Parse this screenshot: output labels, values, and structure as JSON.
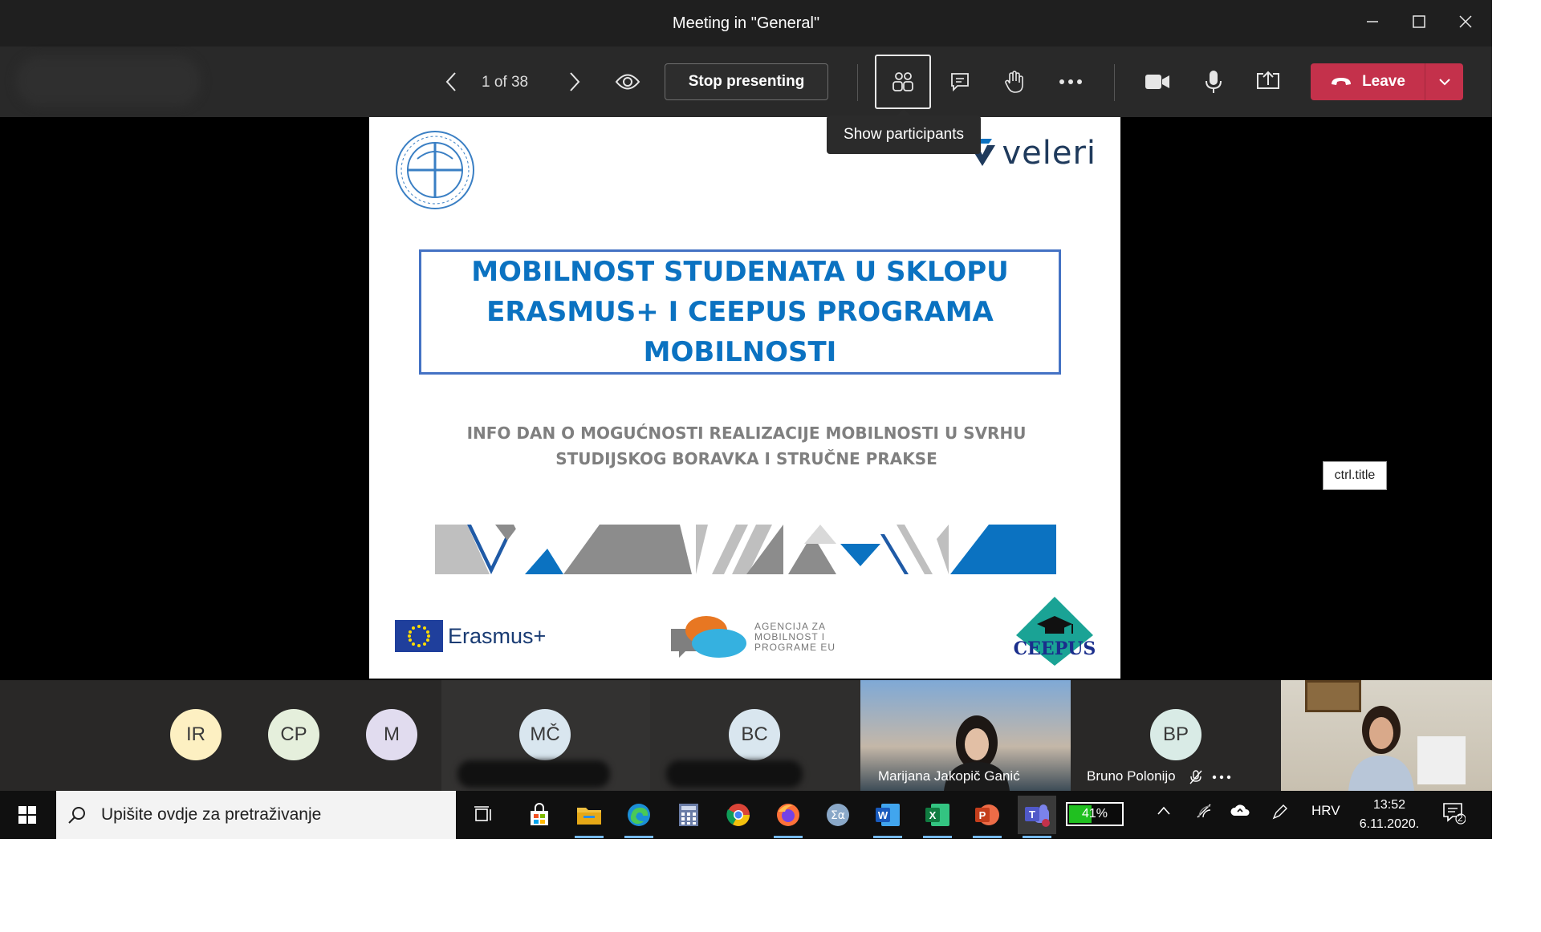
{
  "window": {
    "title": "Meeting in \"General\"",
    "minimize_icon": "minimize-icon",
    "maximize_icon": "maximize-icon",
    "close_icon": "close-icon"
  },
  "toolbar": {
    "page_count": "1 of 38",
    "stop_presenting": "Stop presenting",
    "leave": "Leave",
    "tooltip": "Show participants"
  },
  "slide": {
    "brand": "veleri",
    "title": "MOBILNOST STUDENATA U SKLOPU ERASMUS+ I CEEPUS PROGRAMA MOBILNOSTI",
    "subtitle": "INFO DAN O MOGUĆNOSTI REALIZACIJE MOBILNOSTI U SVRHU STUDIJSKOG BORAVKA I STRUČNE PRAKSE",
    "erasmus": "Erasmus+",
    "agency": [
      "AGENCIJA ZA",
      "MOBILNOST I",
      "PROGRAME EU"
    ],
    "ceepus": "CEEPUS",
    "accent_color": "#0b72c1",
    "grey_text_color": "#7f7f7f"
  },
  "ctrl_tooltip": "ctrl.title",
  "participants": [
    {
      "initials": "IR",
      "color": "#fdf0c2"
    },
    {
      "initials": "CP",
      "color": "#e5efdc"
    },
    {
      "initials": "M",
      "color": "#e1dcef"
    },
    {
      "initials": "MČ",
      "color": "#d9e6ef"
    },
    {
      "initials": "BC",
      "color": "#d9e6ef"
    },
    {
      "name": "Marijana Jakopič Ganić"
    },
    {
      "initials": "BP",
      "color": "#d9ebe6",
      "name": "Bruno Polonijo"
    }
  ],
  "taskbar": {
    "search_placeholder": "Upišite ovdje za pretraživanje",
    "battery": "41%",
    "language": "HRV",
    "time": "13:52",
    "date": "6.11.2020.",
    "notifications": "2"
  },
  "colors": {
    "leave_red": "#c4314b",
    "teams_purple": "#6264a7"
  }
}
